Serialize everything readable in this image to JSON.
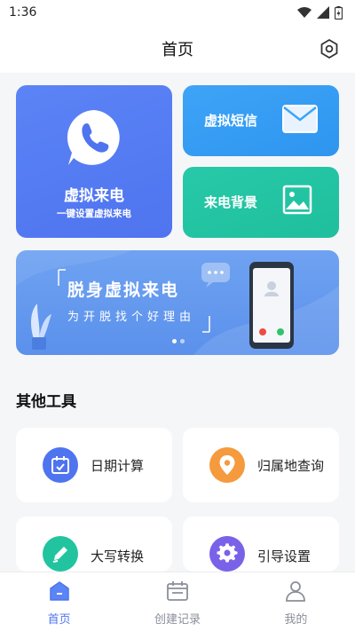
{
  "status_bar": {
    "time": "1:36"
  },
  "header": {
    "title": "首页"
  },
  "cards": {
    "virtual_call": {
      "title": "虚拟来电",
      "subtitle": "一键设置虚拟来电"
    },
    "virtual_sms": {
      "title": "虚拟短信"
    },
    "call_background": {
      "title": "来电背景"
    }
  },
  "banner": {
    "title": "脱身虚拟来电",
    "subtitle": "为开脱找个好理由",
    "page_count": 2,
    "active_page": 1
  },
  "tools_section": {
    "title": "其他工具",
    "items": [
      {
        "label": "日期计算",
        "icon": "calendar-icon",
        "color": "#4f74ef"
      },
      {
        "label": "归属地查询",
        "icon": "location-icon",
        "color": "#f59a3d"
      },
      {
        "label": "大写转换",
        "icon": "pen-icon",
        "color": "#21c49f"
      },
      {
        "label": "引导设置",
        "icon": "gear-icon",
        "color": "#7a62e8"
      }
    ]
  },
  "tabbar": {
    "items": [
      {
        "label": "首页",
        "icon": "home-icon",
        "active": true
      },
      {
        "label": "创建记录",
        "icon": "record-icon",
        "active": false
      },
      {
        "label": "我的",
        "icon": "profile-icon",
        "active": false
      }
    ]
  },
  "colors": {
    "accent": "#4f74ef",
    "sms": "#3ea4f7",
    "background": "#1fbf9d"
  }
}
